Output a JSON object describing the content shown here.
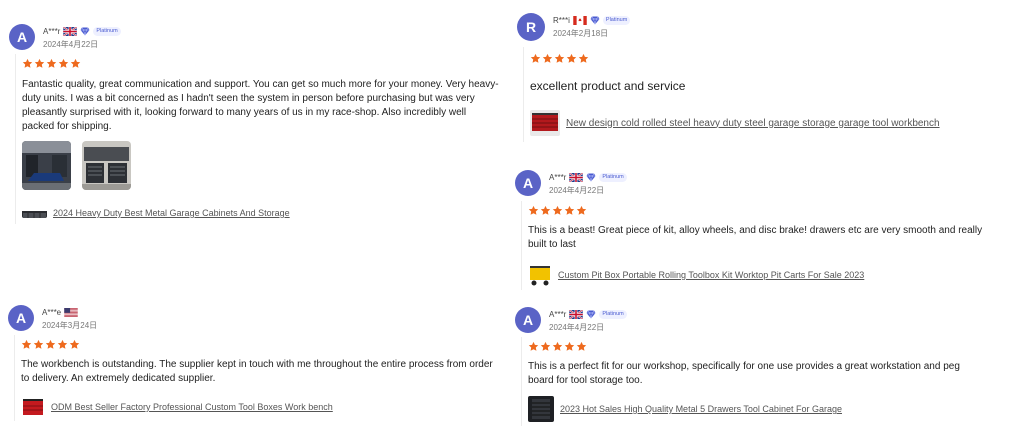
{
  "colors": {
    "avatar": "#5a63c6",
    "star": "#ee6a1e",
    "link": "#555555",
    "platinum": "#4a5bd0"
  },
  "reviews": [
    {
      "initial": "A",
      "username": "A***r",
      "flag": "uk-flag-icon",
      "badge": "Platinum",
      "date": "2024年4月22日",
      "rating": 5,
      "text": "Fantastic quality, great communication and support. You can get so much more for your money. Very heavy-duty units. I was a bit concerned as I hadn't seen the system in person before purchasing but was very pleasantly surprised with it, looking forward to many years of us in my race-shop. Also incredibly well packed for shipping.",
      "photos": 2,
      "product": "2024 Heavy Duty Best Metal Garage Cabinets And Storage"
    },
    {
      "initial": "R",
      "username": "R***i",
      "flag": "canada-flag-icon",
      "badge": "Platinum",
      "date": "2024年2月18日",
      "rating": 5,
      "text": "excellent product and service",
      "product": "New design cold rolled steel heavy duty steel garage storage garage tool workbench"
    },
    {
      "initial": "A",
      "username": "A***r",
      "flag": "uk-flag-icon",
      "badge": "Platinum",
      "date": "2024年4月22日",
      "rating": 5,
      "text": "This is a beast! Great piece of kit, alloy wheels, and disc brake! drawers etc are very smooth and really built to last",
      "product": "Custom Pit Box Portable Rolling Toolbox Kit Worktop Pit Carts For Sale 2023"
    },
    {
      "initial": "A",
      "username": "A***e",
      "flag": "us-flag-icon",
      "date": "2024年3月24日",
      "rating": 5,
      "text": "The workbench is outstanding. The supplier kept in touch with me throughout the entire process from order to delivery. An extremely dedicated supplier.",
      "product": "ODM Best Seller Factory Professional Custom Tool Boxes Work bench"
    },
    {
      "initial": "A",
      "username": "A***r",
      "flag": "uk-flag-icon",
      "badge": "Platinum",
      "date": "2024年4月22日",
      "rating": 5,
      "text": "This is a perfect fit for our workshop, specifically for one use provides a great workstation and peg board for tool storage too.",
      "product": "2023 Hot Sales High Quality Metal 5 Drawers Tool Cabinet For Garage"
    }
  ]
}
